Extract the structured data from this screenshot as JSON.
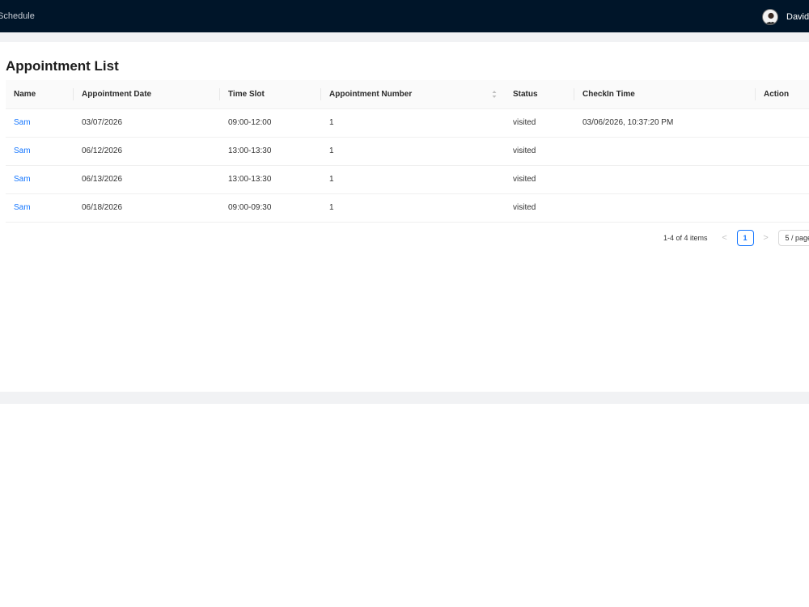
{
  "topbar": {
    "nav_label": "Schedule",
    "user_name": "David S"
  },
  "page": {
    "title": "Appointment List"
  },
  "table": {
    "columns": [
      "Name",
      "Appointment Date",
      "Time Slot",
      "Appointment Number",
      "Status",
      "CheckIn Time",
      "Action"
    ],
    "rows": [
      {
        "name": "Sam",
        "date": "03/07/2026",
        "slot": "09:00-12:00",
        "number": "1",
        "status": "visited",
        "checkin": "03/06/2026, 10:37:20 PM",
        "action": ""
      },
      {
        "name": "Sam",
        "date": "06/12/2026",
        "slot": "13:00-13:30",
        "number": "1",
        "status": "visited",
        "checkin": "",
        "action": ""
      },
      {
        "name": "Sam",
        "date": "06/13/2026",
        "slot": "13:00-13:30",
        "number": "1",
        "status": "visited",
        "checkin": "",
        "action": ""
      },
      {
        "name": "Sam",
        "date": "06/18/2026",
        "slot": "09:00-09:30",
        "number": "1",
        "status": "visited",
        "checkin": "",
        "action": ""
      }
    ]
  },
  "pagination": {
    "total_text": "1-4 of 4 items",
    "prev": "<",
    "current_page": "1",
    "next": ">",
    "page_size": "5 / page"
  },
  "colors": {
    "header_bg": "#001529",
    "link": "#1677ff"
  }
}
